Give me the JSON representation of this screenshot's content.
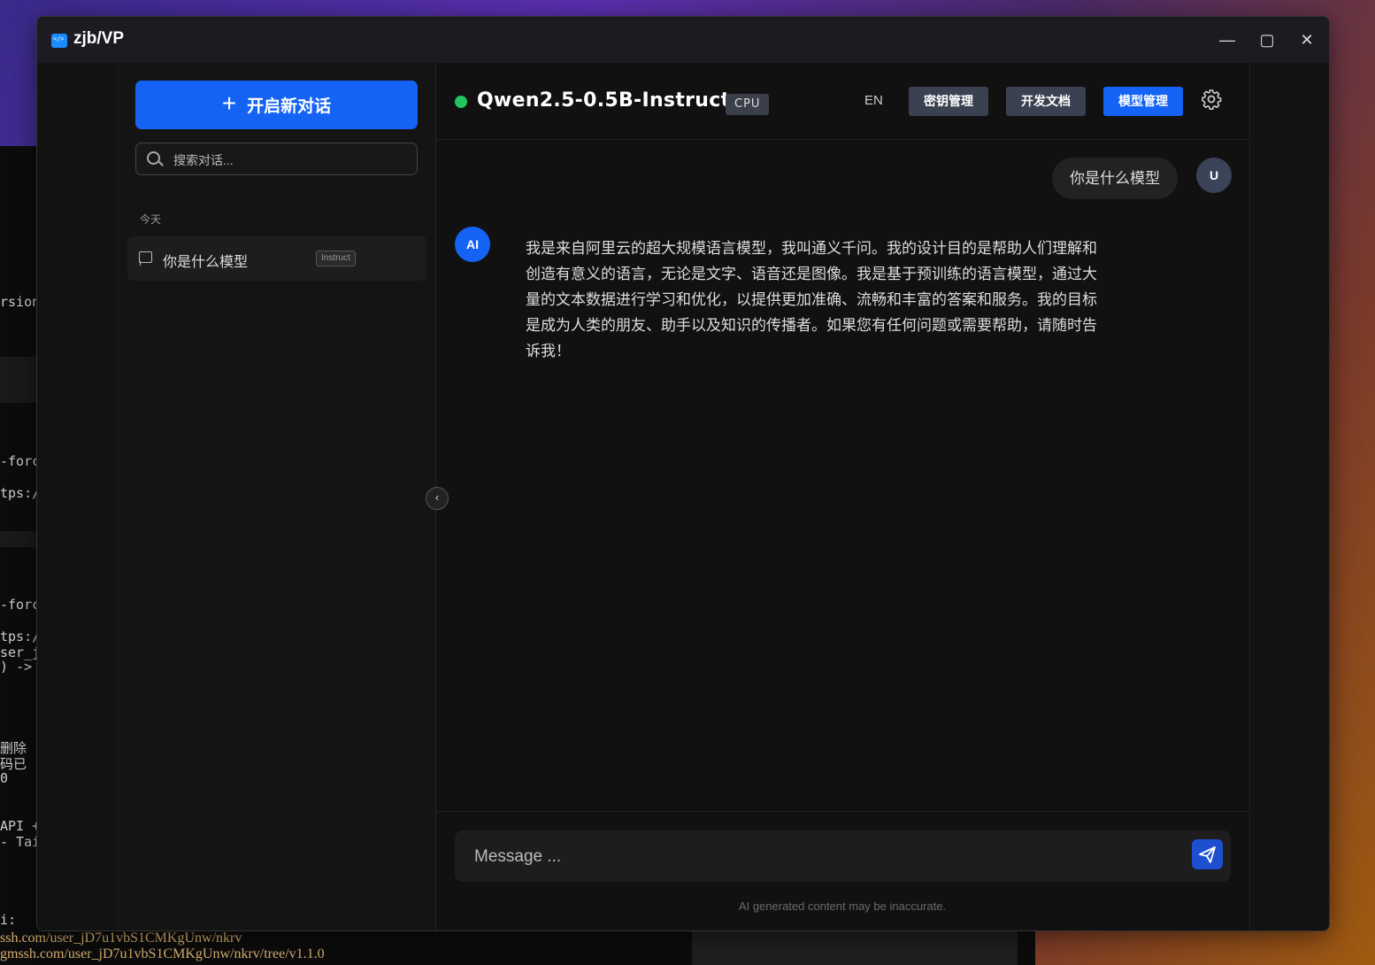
{
  "window": {
    "title": "zjb/VP",
    "controls": {
      "minimize": "—",
      "maximize": "▢",
      "close": "✕"
    }
  },
  "background": {
    "terminal_fragments": [
      "rsion",
      "-force",
      "tps:/",
      "-force",
      "tps:/",
      "ser_j",
      ") -> ",
      "删除",
      "码已",
      "0",
      "API +",
      "- Tai",
      "i:"
    ],
    "bottom_lines": [
      "ssh.com/user_jD7u1vbS1CMKgUnw/nkrv",
      "gmssh.com/user_jD7u1vbS1CMKgUnw/nkrv/tree/v1.1.0"
    ]
  },
  "sidebar": {
    "new_chat_label": "开启新对话",
    "search_placeholder": "搜索对话...",
    "section_today": "今天",
    "conversations": [
      {
        "title": "你是什么模型",
        "badge": "Instruct"
      }
    ]
  },
  "header": {
    "status": "online",
    "model_name": "Qwen2.5-0.5B-Instruct",
    "device_badge": "CPU",
    "lang_toggle": "EN",
    "buttons": {
      "keys": "密钥管理",
      "docs": "开发文档",
      "models": "模型管理"
    }
  },
  "messages": [
    {
      "role": "user",
      "avatar": "U",
      "text": "你是什么模型"
    },
    {
      "role": "assistant",
      "avatar": "AI",
      "text": "我是来自阿里云的超大规模语言模型，我叫通义千问。我的设计目的是帮助人们理解和创造有意义的语言，无论是文字、语音还是图像。我是基于预训练的语言模型，通过大量的文本数据进行学习和优化，以提供更加准确、流畅和丰富的答案和服务。我的目标是成为人类的朋友、助手以及知识的传播者。如果您有任何问题或需要帮助，请随时告诉我！"
    }
  ],
  "composer": {
    "placeholder": "Message ...",
    "disclaimer": "AI generated content may be inaccurate."
  },
  "colors": {
    "accent": "#1463f5",
    "status_online": "#22c55e",
    "secondary_button": "#3a4150"
  }
}
